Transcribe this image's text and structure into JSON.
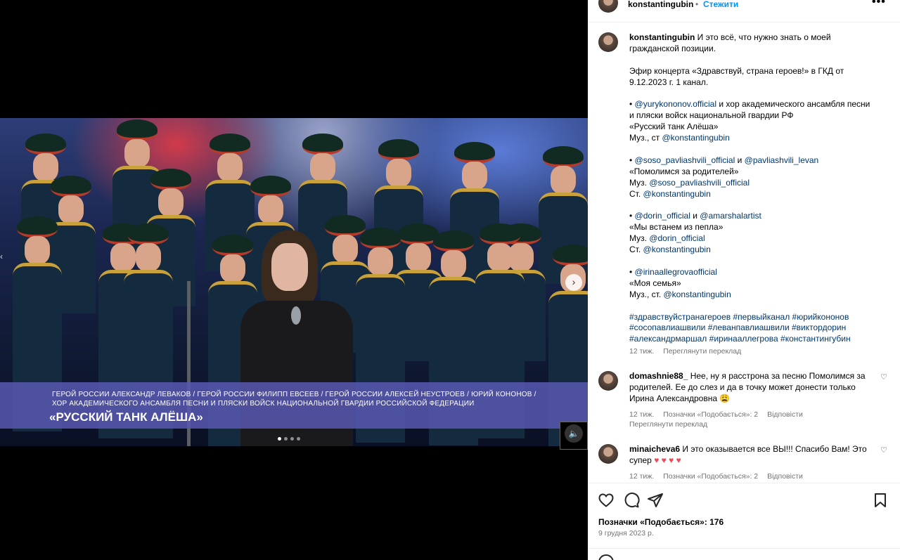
{
  "header": {
    "username": "konstantingubin",
    "separator": "•",
    "follow_label": "Стежити",
    "more_label": "•••"
  },
  "media": {
    "lower_third_line1": "ГЕРОЙ РОССИИ АЛЕКСАНДР ЛЕВАКОВ / ГЕРОЙ РОССИИ ФИЛИПП ЕВСЕЕВ / ГЕРОЙ РОССИИ АЛЕКСЕЙ НЕУСТРОЕВ / ЮРИЙ КОНОНОВ /",
    "lower_third_line2": "ХОР АКАДЕМИЧЕСКОГО АНСАМБЛЯ ПЕСНИ И ПЛЯСКИ ВОЙСК НАЦИОНАЛЬНОЙ ГВАРДИИ РОССИЙСКОЙ ФЕДЕРАЦИИ",
    "lower_third_title": "«РУССКИЙ ТАНК АЛЁША»",
    "next_icon": "chevron-right-icon",
    "mute_icon": "speaker-icon"
  },
  "caption": {
    "username": "konstantingubin",
    "lines": [
      "И это всё, что нужно знать о моей",
      "гражданской позиции.",
      "",
      "Эфир концерта «Здравствуй, страна героев!» в ГКД от",
      "9.12.2023 г. 1 канал.",
      "",
      "• @yurykononov.official и хор академического ансамбля песни",
      "и пляски войск национальной гвардии РФ",
      "«Русский танк Алёша»",
      "Муз., ст @konstantingubin",
      "",
      "• @soso_pavliashvili_official и @pavliashvili_levan",
      "«Помолимся за родителей»",
      "Муз. @soso_pavliashvili_official",
      "Ст. @konstantingubin",
      "",
      "• @dorin_official и @amarshalartist",
      "«Мы встанем из пепла»",
      "Муз. @dorin_official",
      "Ст. @konstantingubin",
      "",
      "• @irinaallegrovaofficial",
      "«Моя семья»",
      "Муз., ст. @konstantingubin",
      "",
      "#здравствуйстранагероев #первыйканал #юрийкононов",
      "#сосопавлиашвили #леванпавлиашвили #виктордорин",
      "#александрмаршал #иринааллегрова #константингубин"
    ],
    "time": "12 тиж.",
    "translate_label": "Переглянути переклад"
  },
  "comments": [
    {
      "username": "domashnie88_",
      "text": "Нее, ну я расстрона за песню Помолимся за родителей. Ее до слез и да в точку может донести только Ирина Александровна 😩",
      "time": "12 тиж.",
      "likes": "Позначки «Подобається»: 2",
      "reply": "Відповісти",
      "translate": "Переглянути переклад"
    },
    {
      "username": "minaicheva6",
      "text": "И это оказывается все ВЫ!!! Спасибо Вам! Это супер",
      "hearts": "♥ ♥ ♥ ♥",
      "time": "12 тиж.",
      "likes": "Позначки «Подобається»: 2",
      "reply": "Відповісти"
    }
  ],
  "footer": {
    "likes": "Позначки «Подобається»: 176",
    "date": "9 грудня 2023 р."
  }
}
